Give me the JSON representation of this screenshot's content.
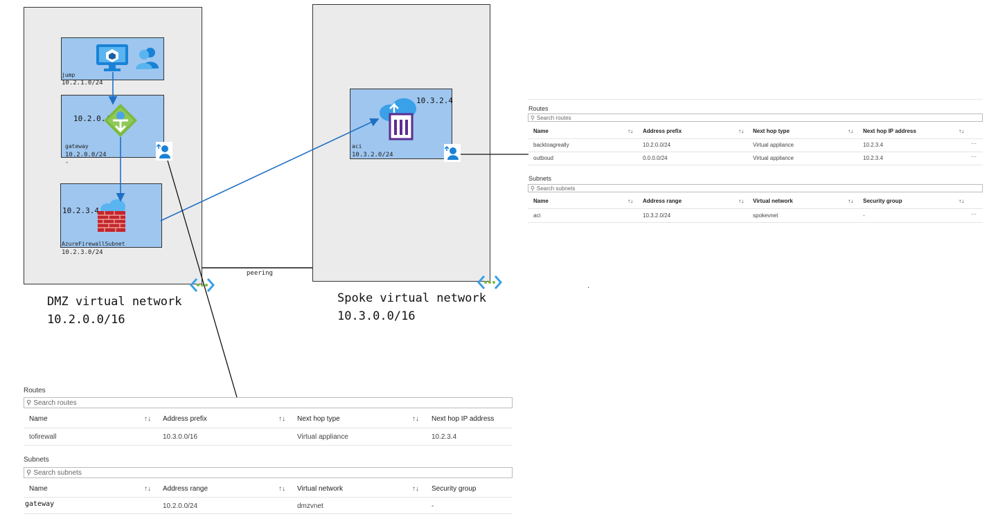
{
  "dmz": {
    "name_line1": "DMZ virtual network",
    "name_line2": "10.2.0.0/16",
    "subnets": {
      "jump": {
        "name": "jump",
        "prefix": "10.2.1.0/24"
      },
      "gateway": {
        "name": "gateway",
        "prefix": "10.2.0.0/24",
        "ip": "10.2.0.4",
        "extra": "-"
      },
      "firewall": {
        "name": "AzureFirewallSubnet",
        "prefix": "10.2.3.0/24",
        "ip": "10.2.3.4"
      }
    }
  },
  "spoke": {
    "name_line1": "Spoke virtual network",
    "name_line2": "10.3.0.0/16",
    "subnets": {
      "aci": {
        "name": "aci",
        "prefix": "10.3.2.0/24",
        "ip": "10.3.2.4"
      }
    }
  },
  "peering_label": "peering",
  "dot_label": ".",
  "right_panel": {
    "routes_title": "Routes",
    "routes_search": "Search routes",
    "routes_headers": [
      "Name",
      "Address prefix",
      "Next hop type",
      "Next hop IP address"
    ],
    "routes": [
      {
        "name": "backtoagreally",
        "prefix": "10.2.0.0/24",
        "type": "Virtual appliance",
        "ip": "10.2.3.4",
        "more": "···"
      },
      {
        "name": "outboud",
        "prefix": "0.0.0.0/24",
        "type": "Virtual appliance",
        "ip": "10.2.3.4",
        "more": "···"
      }
    ],
    "subnets_title": "Subnets",
    "subnets_search": "Search subnets",
    "subnets_headers": [
      "Name",
      "Address range",
      "Virtual network",
      "Security group"
    ],
    "subnets": [
      {
        "name": "aci",
        "range": "10.3.2.0/24",
        "vnet": "spokevnet",
        "nsg": "-",
        "more": "···"
      }
    ]
  },
  "bottom_panel": {
    "routes_title": "Routes",
    "routes_search": "Search routes",
    "routes_headers": [
      "Name",
      "Address prefix",
      "Next hop type",
      "Next hop IP address"
    ],
    "routes": [
      {
        "name": "tofirewall",
        "prefix": "10.3.0.0/16",
        "type": "Virtual appliance",
        "ip": "10.2.3.4"
      }
    ],
    "subnets_title": "Subnets",
    "subnets_search": "Search subnets",
    "subnets_headers": [
      "Name",
      "Address range",
      "Virtual network",
      "Security group"
    ],
    "subnets": [
      {
        "name": "gateway",
        "range": "10.2.0.0/24",
        "vnet": "dmzvnet",
        "nsg": "-"
      }
    ]
  },
  "sort_glyph": "↑↓",
  "colors": {
    "subnet": "#9ec6ef",
    "vnet": "#ebebeb",
    "arrow": "#1f6fc4",
    "line": "#111111"
  }
}
